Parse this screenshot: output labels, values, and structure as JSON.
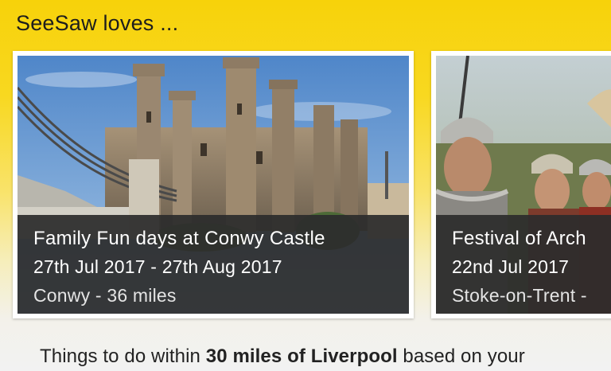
{
  "section": {
    "title": "SeeSaw loves ..."
  },
  "cards": [
    {
      "title": "Family Fun days at Conwy Castle",
      "dates": "27th Jul 2017 - 27th Aug 2017",
      "location": "Conwy - 36 miles",
      "image_icon": "castle-photo"
    },
    {
      "title": "Festival of Arch",
      "dates": "22nd Jul 2017",
      "location": "Stoke-on-Trent -",
      "image_icon": "roman-soldiers-photo"
    }
  ],
  "intro": {
    "prefix": "Things to do within ",
    "highlight": "30 miles of Liverpool",
    "suffix": " based on your"
  },
  "colors": {
    "accent_yellow": "#f7d20a",
    "overlay": "#2c2c2c",
    "text_dark": "#1d1d1d"
  }
}
